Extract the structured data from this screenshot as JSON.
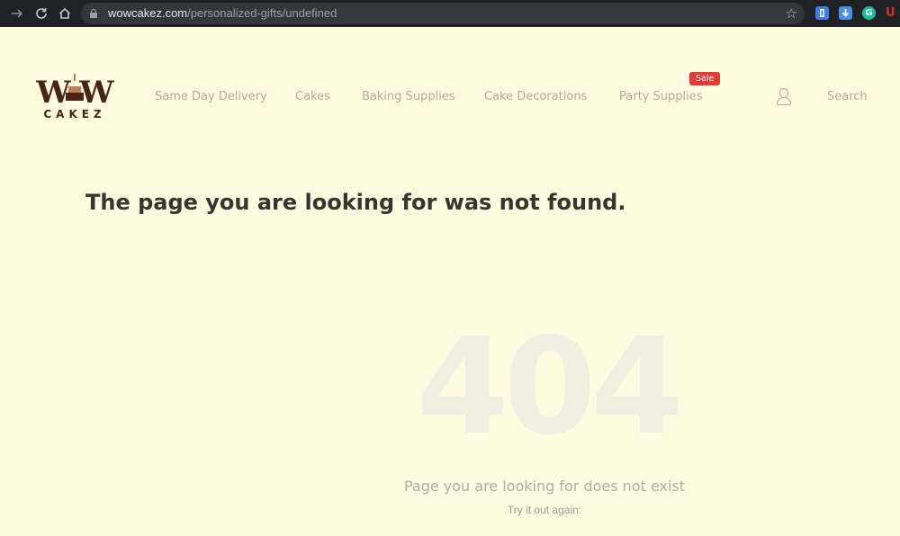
{
  "browser": {
    "url_host": "wowcakez.com",
    "url_path": "/personalized-gifts/undefined",
    "icons": [
      "forward-arrow-icon",
      "reload-icon",
      "home-icon",
      "lock-icon",
      "bookmark-star-icon"
    ],
    "extensions": [
      {
        "name": "extension-blue-icon",
        "glyph": "▮",
        "color": "#3f7ee8"
      },
      {
        "name": "extension-download-icon",
        "glyph": "⬇",
        "color": "#4a90e2"
      },
      {
        "name": "grammarly-icon",
        "glyph": "G",
        "color": "#15c39a"
      },
      {
        "name": "extension-red-u-icon",
        "glyph": "U",
        "color": "#d93025"
      }
    ]
  },
  "logo": {
    "word_top": "W W",
    "word_bottom": "CAKEZ"
  },
  "nav": {
    "items": [
      "Same Day Delivery",
      "Cakes",
      "Baking Supplies",
      "Cake Decorations",
      "Party Supplies"
    ],
    "sale_badge": "Sale",
    "search_label": "Search",
    "color": "#b7a99c"
  },
  "main": {
    "title": "The page you are looking for was not found.",
    "big_code": "404",
    "subtitle": "Page you are looking for does not exist",
    "hint": "Try it out again:"
  },
  "colors": {
    "background": "#fffbe0",
    "brand": "#4a2418",
    "sale": "#e53935"
  }
}
